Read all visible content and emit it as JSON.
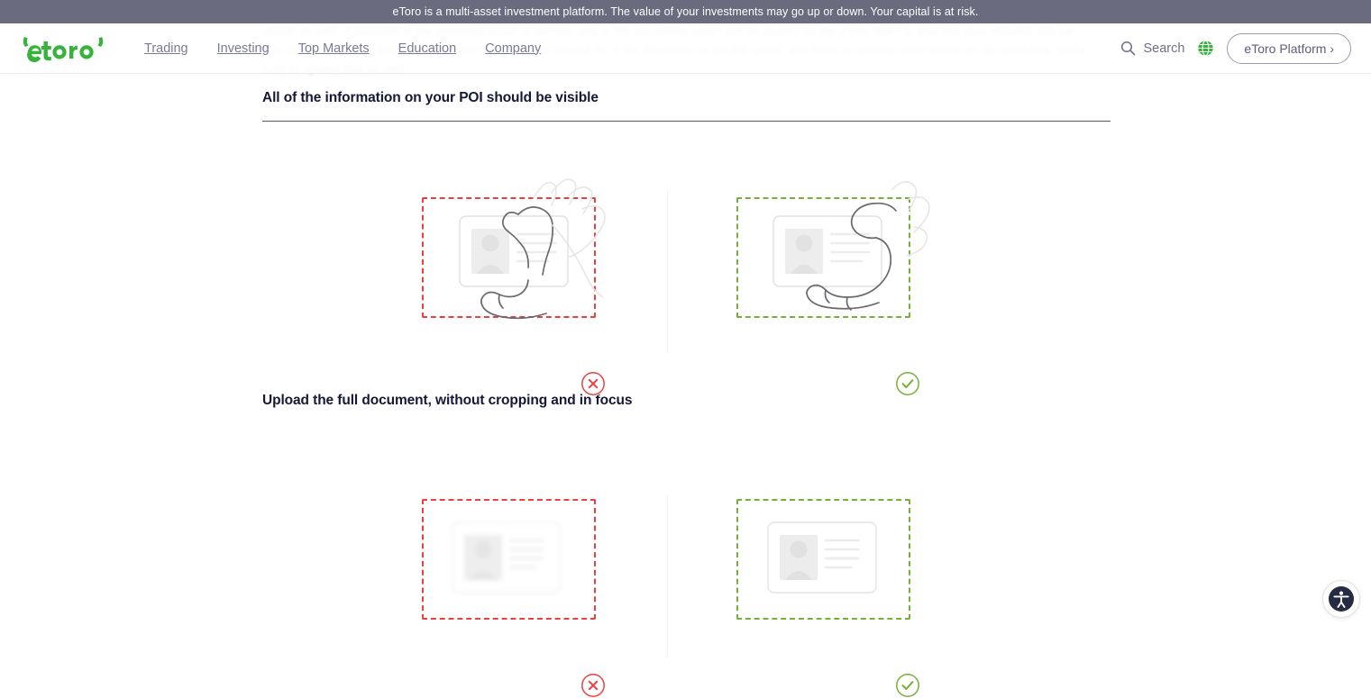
{
  "risk_banner": {
    "text": "eToro is a multi-asset investment platform. The value of your investments may go up or down. Your capital is at risk."
  },
  "ghost_text": {
    "content": "visible as well. A passport is the preferred proof of identity, and is the document which will be quoted by the eToro team to process your request, but we also accept a driving licence or any other government-issued ID. If the document is double-sided, and there is relevant information on the backside, make sure to upload that as well."
  },
  "header": {
    "logo_label": "eToro",
    "nav": [
      {
        "label": "Trading"
      },
      {
        "label": "Investing"
      },
      {
        "label": "Top Markets"
      },
      {
        "label": "Education"
      },
      {
        "label": "Company"
      }
    ],
    "search_label": "Search",
    "search_icon": "search-icon",
    "language_icon": "globe-icon",
    "platform_button": "eToro Platform ›"
  },
  "sections": [
    {
      "title": "All of the information on your POI should be visible",
      "bad": {
        "state": "invalid",
        "badge_icon": "x-circle-icon",
        "illustration": "hand-covering-id-card"
      },
      "good": {
        "state": "valid",
        "badge_icon": "check-circle-icon",
        "illustration": "hand-holding-id-card-edge"
      }
    },
    {
      "title": "Upload the full document, without cropping and in focus",
      "bad": {
        "state": "invalid",
        "badge_icon": "x-circle-icon",
        "illustration": "blurred-id-card"
      },
      "good": {
        "state": "valid",
        "badge_icon": "check-circle-icon",
        "illustration": "sharp-id-card"
      }
    }
  ],
  "accessibility": {
    "label": "Accessibility",
    "icon": "accessibility-person-icon"
  },
  "colors": {
    "brand_green": "#35b33a",
    "banner_bg": "#6b6b80",
    "heading": "#131936",
    "nav_text": "#7a7a92",
    "invalid_red": "#e8413f",
    "valid_green": "#74b136",
    "card_grey": "#ececed",
    "a11y_navy": "#252b42"
  }
}
